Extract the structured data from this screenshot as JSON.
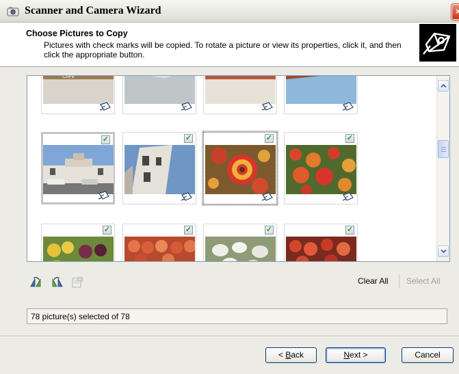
{
  "window": {
    "title": "Scanner and Camera Wizard",
    "close_glyph": "×"
  },
  "header": {
    "title": "Choose Pictures to Copy",
    "description": "Pictures with check marks will be copied. To rotate a picture or view its properties, click it, and then click the appropriate button.",
    "logo_icon": "wizard-camera-logo-icon"
  },
  "thumbnails": [
    {
      "checked": false,
      "icon": "camera-item-icon",
      "scene": "building-cafe-top"
    },
    {
      "checked": false,
      "icon": "camera-item-icon",
      "scene": "building-sign-top"
    },
    {
      "checked": false,
      "icon": "camera-item-icon",
      "scene": "building-facade-top"
    },
    {
      "checked": false,
      "icon": "camera-item-icon",
      "scene": "building-red-top"
    },
    {
      "checked": true,
      "icon": "camera-item-icon",
      "scene": "street-building"
    },
    {
      "checked": true,
      "icon": "camera-item-icon",
      "scene": "tilted-building"
    },
    {
      "checked": true,
      "icon": "camera-item-icon",
      "scene": "flower-closeup"
    },
    {
      "checked": true,
      "icon": "camera-item-icon",
      "scene": "flower-field"
    },
    {
      "checked": true,
      "icon": "camera-item-icon",
      "scene": "fruit-market"
    },
    {
      "checked": true,
      "icon": "camera-item-icon",
      "scene": "peaches"
    },
    {
      "checked": true,
      "icon": "camera-item-icon",
      "scene": "mushrooms"
    },
    {
      "checked": true,
      "icon": "camera-item-icon",
      "scene": "apples"
    }
  ],
  "checkmark_glyph": "✓",
  "toolbar": {
    "rotate_left_icon": "rotate-left-icon",
    "rotate_right_icon": "rotate-right-icon",
    "properties_icon": "properties-icon",
    "clear_all": "Clear All",
    "select_all": "Select All"
  },
  "status": "78 picture(s) selected of 78",
  "buttons": {
    "back_prefix": "< ",
    "back_key": "B",
    "back_rest": "ack",
    "next_key": "N",
    "next_rest": "ext >",
    "cancel": "Cancel"
  },
  "colors": {
    "dialog_bg": "#ecebe5",
    "panel_border": "#7f9db9",
    "check_green": "#20a020",
    "disabled_text": "#a0a0a0"
  }
}
